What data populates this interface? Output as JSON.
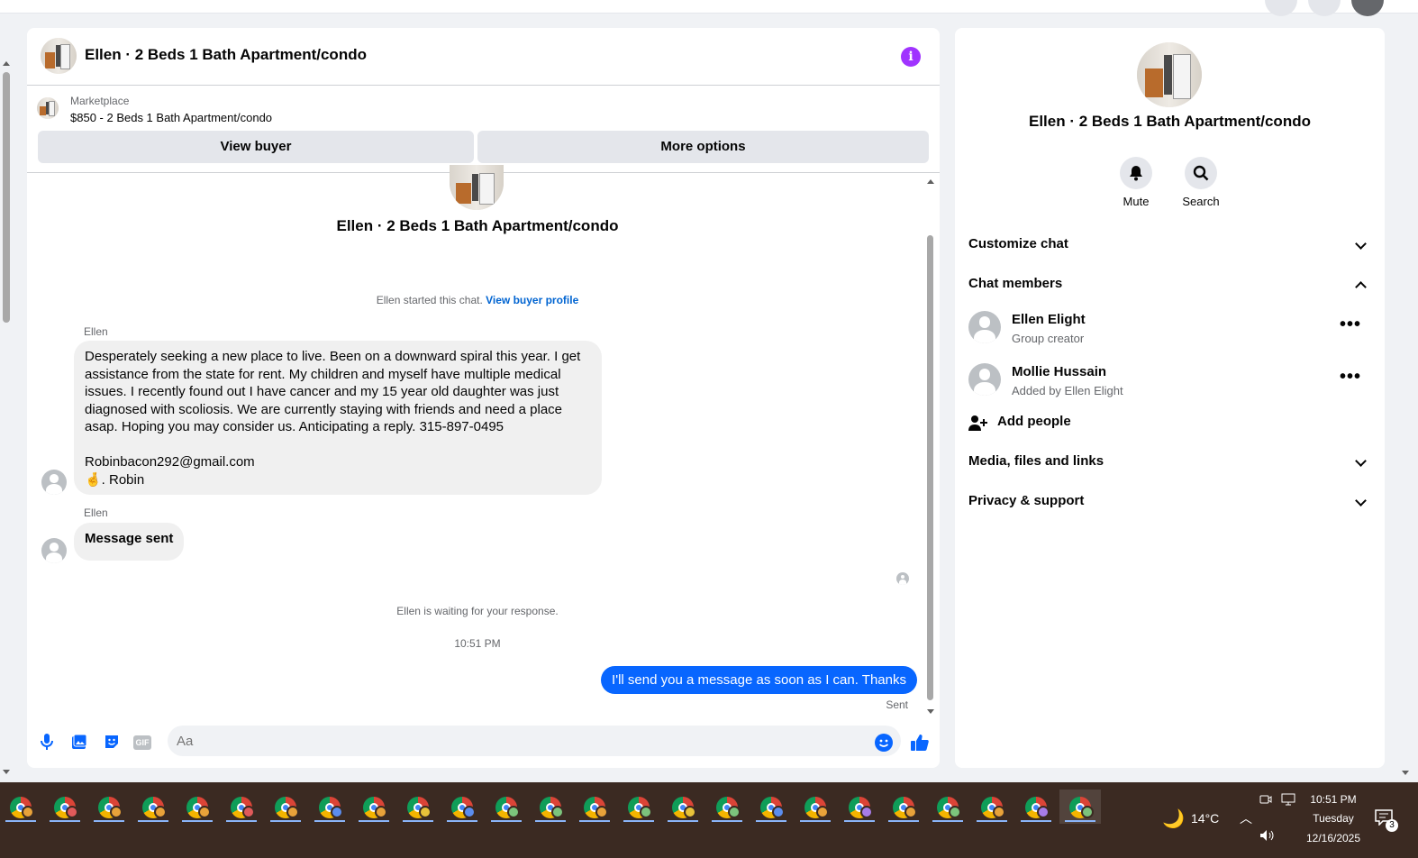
{
  "chat": {
    "header_title": "Ellen · 2 Beds 1 Bath Apartment/condo",
    "info_icon": "i",
    "marketplace_label": "Marketplace",
    "listing": "$850 - 2 Beds 1 Bath Apartment/condo",
    "view_buyer": "View buyer",
    "more_options": "More options",
    "center_title": "Ellen · 2 Beds 1 Bath Apartment/condo",
    "started_text": "Ellen started this chat.",
    "view_buyer_profile": "View buyer profile",
    "messages": [
      {
        "sender": "Ellen",
        "lines": [
          "Desperately seeking a new place to live.  Been on a downward spiral this year.  I get",
          "assistance from the state for rent.  My children and myself have multiple medical",
          "issues. I recently found out I have cancer and my 15 year old daughter was just",
          "diagnosed with scoliosis.  We are currently staying with friends and need a place",
          "asap.  Hoping you may consider us. Anticipating a reply. 315-897-0495",
          "",
          "Robinbacon292@gmail.com",
          "🤞. Robin"
        ]
      },
      {
        "sender": "Ellen",
        "text": "Message sent"
      }
    ],
    "waiting_text": "Ellen is waiting for your response.",
    "timestamp": "10:51 PM",
    "outgoing": "I'll send you a message as soon as I can. Thanks",
    "sent_status": "Sent",
    "composer_placeholder": "Aa",
    "gif_label": "GIF"
  },
  "side": {
    "title": "Ellen · 2 Beds 1 Bath Apartment/condo",
    "mute": "Mute",
    "search": "Search",
    "customize_chat": "Customize chat",
    "chat_members": "Chat members",
    "members": [
      {
        "name": "Ellen Elight",
        "role": "Group creator"
      },
      {
        "name": "Mollie Hussain",
        "role": "Added by Ellen Elight"
      }
    ],
    "add_people": "Add people",
    "media": "Media, files and links",
    "privacy": "Privacy & support"
  },
  "taskbar": {
    "weather": "14°C",
    "time": "10:51 PM",
    "day": "Tuesday",
    "date": "12/16/2025",
    "notifications": "3",
    "badge_colors": [
      "#e8a23a",
      "#e05a5a",
      "#e8a23a",
      "#e8a23a",
      "#e8a23a",
      "#e05a5a",
      "#e8a23a",
      "#5b8def",
      "#e8a23a",
      "#e8c23a",
      "#5b8def",
      "#7cc47c",
      "#7cc47c",
      "#e8a23a",
      "#7cc47c",
      "#e8c23a",
      "#7cc47c",
      "#5b8def",
      "#e8a23a",
      "#a77ce8",
      "#e8a23a",
      "#7cc47c",
      "#e8a23a",
      "#a77ce8",
      "#7cc47c"
    ]
  },
  "colors": {
    "accent": "#0866ff",
    "info": "#a033ff",
    "taskbar": "#3b2a22"
  }
}
